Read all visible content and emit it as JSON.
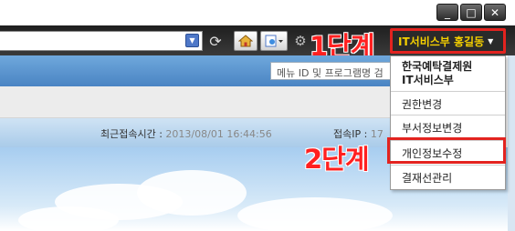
{
  "window": {
    "minimize_glyph": "_",
    "maximize_glyph": "□",
    "close_glyph": "✕"
  },
  "toolbar": {
    "address_dropdown_icon": "dropdown-arrow-icon",
    "refresh_icon": "refresh-icon",
    "home_icon": "home-icon",
    "page_icon": "page-icon",
    "settings_icon": "gear-icon"
  },
  "annotations": {
    "step1": "1단계",
    "step2": "2단계"
  },
  "user_button": {
    "label": "IT서비스부  홍길동",
    "caret": "▼"
  },
  "menu_search": {
    "placeholder": "메뉴 ID 및 프로그램명 검"
  },
  "info": {
    "last_login_label": "최근접속시간 : ",
    "last_login_value": "2013/08/01 16:44:56",
    "ip_label": "접속IP : ",
    "ip_value": "17"
  },
  "dropdown": {
    "org": "한국예탁결제원",
    "dept": "IT서비스부",
    "items": [
      "권한변경",
      "부서정보변경",
      "개인정보수정",
      "결재선관리"
    ]
  },
  "colors": {
    "highlight": "#e3231f",
    "user_name": "#f5d000",
    "toolbar": "#2a2a2a"
  }
}
